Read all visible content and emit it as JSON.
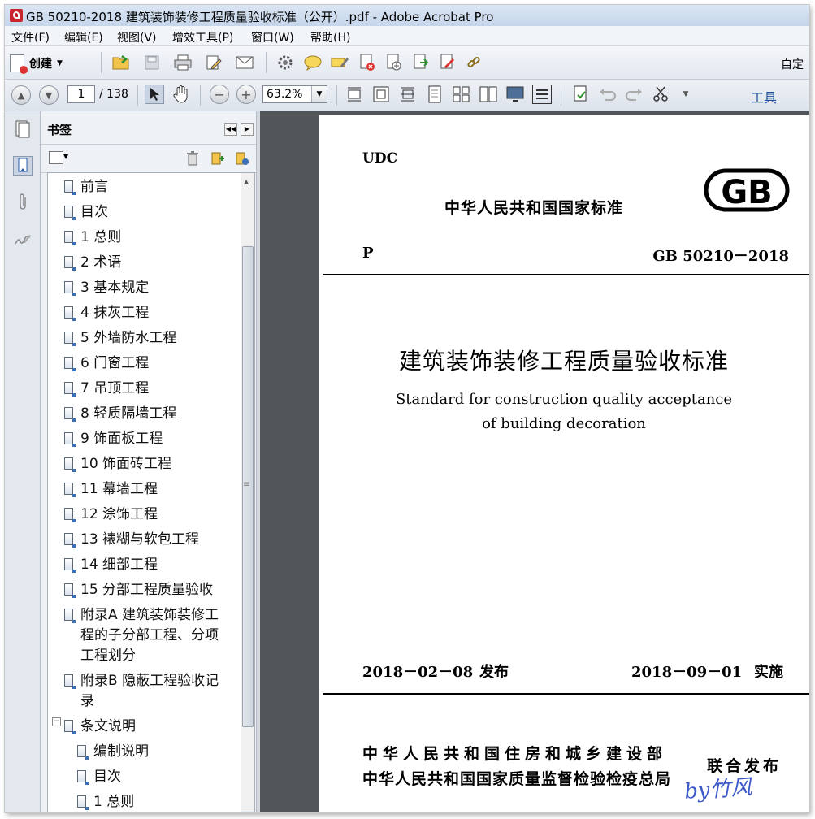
{
  "window": {
    "title": "GB 50210-2018 建筑装饰装修工程质量验收标准（公开）.pdf - Adobe Acrobat Pro"
  },
  "menu": {
    "items": [
      "文件(F)",
      "编辑(E)",
      "视图(V)",
      "增效工具(P)",
      "窗口(W)",
      "帮助(H)"
    ]
  },
  "toolbar": {
    "create_label": "创建",
    "customize_label": "自定",
    "icons": [
      "open-folder-icon",
      "save-icon",
      "print-icon",
      "edit-icon",
      "email-icon",
      "settings-icon",
      "comment-icon",
      "highlight-icon",
      "delete-page-icon",
      "export-icon",
      "extract-icon",
      "sign-icon",
      "link-icon"
    ]
  },
  "navbar": {
    "page_current": "1",
    "page_total": "/ 138",
    "zoom": "63.2%",
    "tools_label": "工具"
  },
  "bookmarks": {
    "title": "书签",
    "items": [
      {
        "label": "前言",
        "level": 0
      },
      {
        "label": "目次",
        "level": 0
      },
      {
        "label": "1 总则",
        "level": 0
      },
      {
        "label": "2 术语",
        "level": 0
      },
      {
        "label": "3 基本规定",
        "level": 0
      },
      {
        "label": "4 抹灰工程",
        "level": 0
      },
      {
        "label": "5 外墙防水工程",
        "level": 0
      },
      {
        "label": "6 门窗工程",
        "level": 0
      },
      {
        "label": "7 吊顶工程",
        "level": 0
      },
      {
        "label": "8 轻质隔墙工程",
        "level": 0
      },
      {
        "label": "9 饰面板工程",
        "level": 0
      },
      {
        "label": "10 饰面砖工程",
        "level": 0
      },
      {
        "label": "11 幕墙工程",
        "level": 0
      },
      {
        "label": "12 涂饰工程",
        "level": 0
      },
      {
        "label": "13 裱糊与软包工程",
        "level": 0
      },
      {
        "label": "14 细部工程",
        "level": 0
      },
      {
        "label": "15 分部工程质量验收",
        "level": 0
      },
      {
        "label": "附录A 建筑装饰装修工\n程的子分部工程、分项\n工程划分",
        "level": 0
      },
      {
        "label": "附录B 隐蔽工程验收记\n录",
        "level": 0
      },
      {
        "label": "条文说明",
        "level": 0,
        "expanded": true
      },
      {
        "label": "编制说明",
        "level": 1
      },
      {
        "label": "目次",
        "level": 1
      },
      {
        "label": "1 总则",
        "level": 1
      }
    ]
  },
  "document": {
    "udc": "UDC",
    "national_standard": "中华人民共和国国家标准",
    "gb_logo": "GB",
    "category": "P",
    "code": "GB 50210－2018",
    "title_cn": "建筑装饰装修工程质量验收标准",
    "title_en_line1": "Standard for construction quality acceptance",
    "title_en_line2": "of building decoration",
    "issue_date": "2018－02－08",
    "issue_label": "发布",
    "impl_date": "2018－09－01",
    "impl_label": "实施",
    "issuer1": "中华人民共和国住房和城乡建设部",
    "issuer2": "中华人民共和国国家质量监督检验检疫总局",
    "joint_issue": "联合发布"
  },
  "watermark": "by竹风"
}
